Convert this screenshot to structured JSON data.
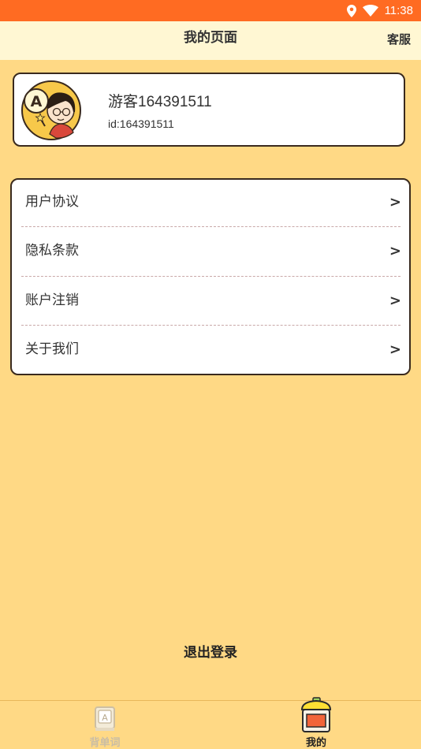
{
  "status_bar": {
    "time": "11:38",
    "icons": [
      "location-icon",
      "wifi-icon"
    ],
    "background": "#FF6B22"
  },
  "header": {
    "title": "我的页面",
    "service_label": "客服"
  },
  "profile": {
    "username": "游客164391511",
    "user_id": "id:164391511",
    "avatar_letter": "A"
  },
  "menu": {
    "items": [
      {
        "label": "用户协议",
        "arrow": ">"
      },
      {
        "label": "隐私条款",
        "arrow": ">"
      },
      {
        "label": "账户注销",
        "arrow": ">"
      },
      {
        "label": "关于我们",
        "arrow": ">"
      }
    ]
  },
  "logout_label": "退出登录",
  "tabs": [
    {
      "label": "背单词",
      "icon": "word-book-icon",
      "active": false
    },
    {
      "label": "我的",
      "icon": "profile-box-icon",
      "active": true
    }
  ],
  "colors": {
    "page_background": "#FFD985",
    "header_background": "#FFF7D3",
    "accent": "#FF6B22"
  }
}
